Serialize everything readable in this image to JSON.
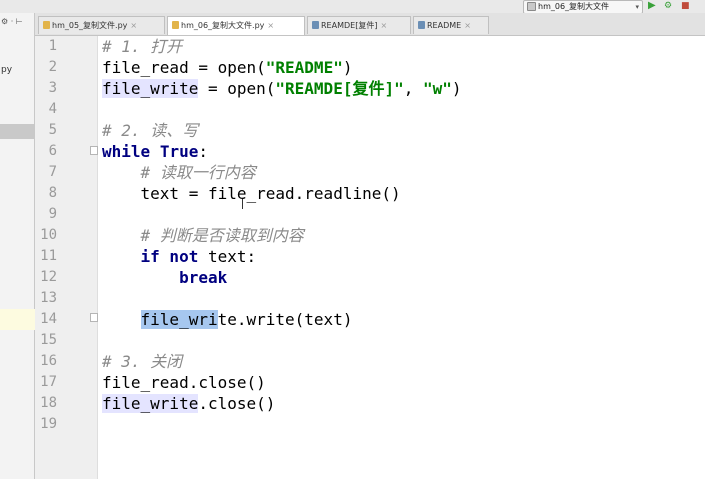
{
  "toolbar": {
    "run_config": "hm_06_复制大文件",
    "caret": "▾",
    "run_icon": "▶",
    "debug_icon": "⚙",
    "stop_icon": "■"
  },
  "sidebar": {
    "gear": "⚙ ·  ⊢",
    "file_suffix": "py"
  },
  "tabs": [
    {
      "label": "hm_05_复制文件.py",
      "close": "×"
    },
    {
      "label": "hm_06_复制大文件.py",
      "close": "×"
    },
    {
      "label": "REAMDE[复件]",
      "close": "×"
    },
    {
      "label": "README",
      "close": "×"
    }
  ],
  "editor": {
    "line_numbers": [
      "1",
      "2",
      "3",
      "4",
      "5",
      "6",
      "7",
      "8",
      "9",
      "10",
      "11",
      "12",
      "13",
      "14",
      "15",
      "16",
      "17",
      "18",
      "19"
    ],
    "current_line": 14,
    "lines": {
      "l1": "# 1. 打开",
      "l2a": "file_read = open(",
      "l2b": "\"README\"",
      "l2c": ")",
      "l3a": "file_write",
      "l3b": " = open(",
      "l3c": "\"REAMDE[复件]\"",
      "l3d": ", ",
      "l3e": "\"w\"",
      "l3f": ")",
      "l5": "# 2. 读、写",
      "l6a": "while",
      "l6b": " ",
      "l6c": "True",
      "l6d": ":",
      "l7": "    # 读取一行内容",
      "l8": "    text = file_read.readline()",
      "l10": "    # 判断是否读取到内容",
      "l11a": "    ",
      "l11b": "if not",
      "l11c": " text:",
      "l12a": "        ",
      "l12b": "break",
      "l14a": "    ",
      "l14b": "file_wri",
      "l14c": "te.write(text)",
      "l16": "# 3. 关闭",
      "l17": "file_read.close()",
      "l18a": "file_write",
      "l18b": ".close()"
    }
  }
}
